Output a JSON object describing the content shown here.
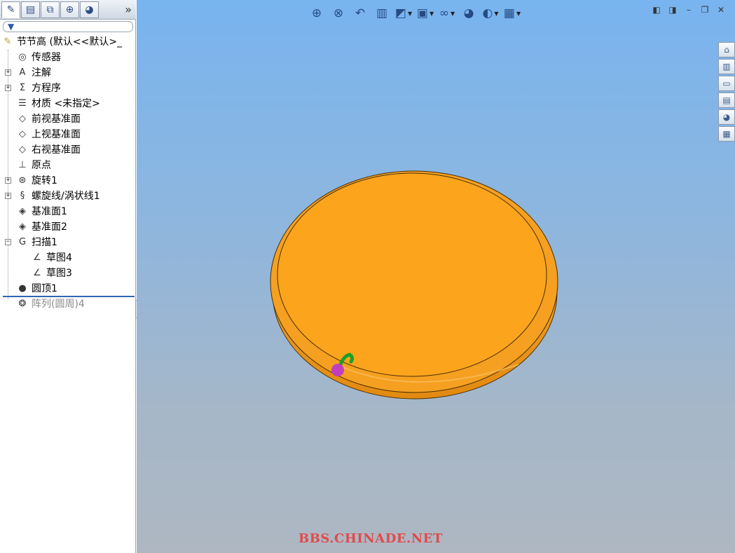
{
  "feature_manager": {
    "tabs": [
      {
        "name": "featuremanager-icon",
        "glyph": "✎"
      },
      {
        "name": "propertymanager-icon",
        "glyph": "▤"
      },
      {
        "name": "configuration-icon",
        "glyph": "⧉"
      },
      {
        "name": "dimxpert-icon",
        "glyph": "⊕"
      },
      {
        "name": "display-manager-icon",
        "glyph": "◕"
      }
    ],
    "expand_glyph": "»",
    "filter_glyph": "▼",
    "tree": [
      {
        "label": "节节高 (默认<<默认>_",
        "level": "root",
        "icon": "part-icon",
        "glyph": "✎",
        "expander": ""
      },
      {
        "label": "传感器",
        "level": "lvl1",
        "icon": "sensors-icon",
        "glyph": "◎",
        "expander": ""
      },
      {
        "label": "注解",
        "level": "lvl1",
        "icon": "annotations-icon",
        "glyph": "A",
        "expander": "+"
      },
      {
        "label": "方程序",
        "level": "lvl1",
        "icon": "equations-icon",
        "glyph": "Σ",
        "expander": "+"
      },
      {
        "label": "材质 <未指定>",
        "level": "lvl1",
        "icon": "material-icon",
        "glyph": "☰",
        "expander": ""
      },
      {
        "label": "前视基准面",
        "level": "lvl1",
        "icon": "plane-icon",
        "glyph": "◇",
        "expander": ""
      },
      {
        "label": "上视基准面",
        "level": "lvl1",
        "icon": "plane-icon",
        "glyph": "◇",
        "expander": ""
      },
      {
        "label": "右视基准面",
        "level": "lvl1",
        "icon": "plane-icon",
        "glyph": "◇",
        "expander": ""
      },
      {
        "label": "原点",
        "level": "lvl1",
        "icon": "origin-icon",
        "glyph": "⊥",
        "expander": ""
      },
      {
        "label": "旋转1",
        "level": "lvl1",
        "icon": "revolve-icon",
        "glyph": "⊛",
        "expander": "+"
      },
      {
        "label": "螺旋线/涡状线1",
        "level": "lvl1",
        "icon": "helix-icon",
        "glyph": "§",
        "expander": "+"
      },
      {
        "label": "基准面1",
        "level": "lvl1",
        "icon": "ref-plane-icon",
        "glyph": "◈",
        "expander": ""
      },
      {
        "label": "基准面2",
        "level": "lvl1",
        "icon": "ref-plane-icon",
        "glyph": "◈",
        "expander": ""
      },
      {
        "label": "扫描1",
        "level": "lvl1",
        "icon": "sweep-icon",
        "glyph": "G",
        "expander": "−"
      },
      {
        "label": "草图4",
        "level": "lvl2",
        "icon": "sketch-icon",
        "glyph": "∠",
        "expander": ""
      },
      {
        "label": "草图3",
        "level": "lvl2",
        "icon": "sketch-icon",
        "glyph": "∠",
        "expander": ""
      },
      {
        "label": "圆顶1",
        "level": "lvl1",
        "icon": "dome-icon",
        "glyph": "●",
        "expander": ""
      },
      {
        "label": "阵列(圆周)4",
        "level": "lvl1",
        "icon": "circular-pattern-icon",
        "glyph": "❂",
        "expander": "",
        "dim": true
      }
    ]
  },
  "view_toolbar": [
    {
      "name": "zoom-to-fit-icon",
      "glyph": "⊕",
      "dropdown": false
    },
    {
      "name": "zoom-to-area-icon",
      "glyph": "⊗",
      "dropdown": false
    },
    {
      "name": "previous-view-icon",
      "glyph": "↶",
      "dropdown": false
    },
    {
      "name": "section-view-icon",
      "glyph": "▥",
      "dropdown": false
    },
    {
      "name": "view-orientation-icon",
      "glyph": "◩",
      "dropdown": true
    },
    {
      "name": "display-style-icon",
      "glyph": "▣",
      "dropdown": true
    },
    {
      "name": "hide-show-items-icon",
      "glyph": "∞",
      "dropdown": true
    },
    {
      "name": "edit-appearance-icon",
      "glyph": "◕",
      "dropdown": false
    },
    {
      "name": "apply-scene-icon",
      "glyph": "◐",
      "dropdown": true
    },
    {
      "name": "view-settings-icon",
      "glyph": "▦",
      "dropdown": true
    }
  ],
  "window_controls": [
    {
      "name": "prev-window-icon",
      "glyph": "◧"
    },
    {
      "name": "next-window-icon",
      "glyph": "◨"
    },
    {
      "name": "minimize-icon",
      "glyph": "–"
    },
    {
      "name": "restore-icon",
      "glyph": "❐"
    },
    {
      "name": "close-icon",
      "glyph": "✕"
    }
  ],
  "task_pane": [
    {
      "name": "solidworks-resources-icon",
      "glyph": "⌂"
    },
    {
      "name": "design-library-icon",
      "glyph": "▥"
    },
    {
      "name": "file-explorer-icon",
      "glyph": "▭"
    },
    {
      "name": "view-palette-icon",
      "glyph": "▤"
    },
    {
      "name": "appearances-icon",
      "glyph": "◕"
    },
    {
      "name": "custom-properties-icon",
      "glyph": "▦"
    }
  ],
  "colors": {
    "model_face": "#fba41c",
    "model_rim": "#f5a020",
    "model_edge": "#4a2e06",
    "marker_green": "#1aa028",
    "marker_magenta": "#c13fbf"
  },
  "watermark": "BBS.CHINADE.NET"
}
